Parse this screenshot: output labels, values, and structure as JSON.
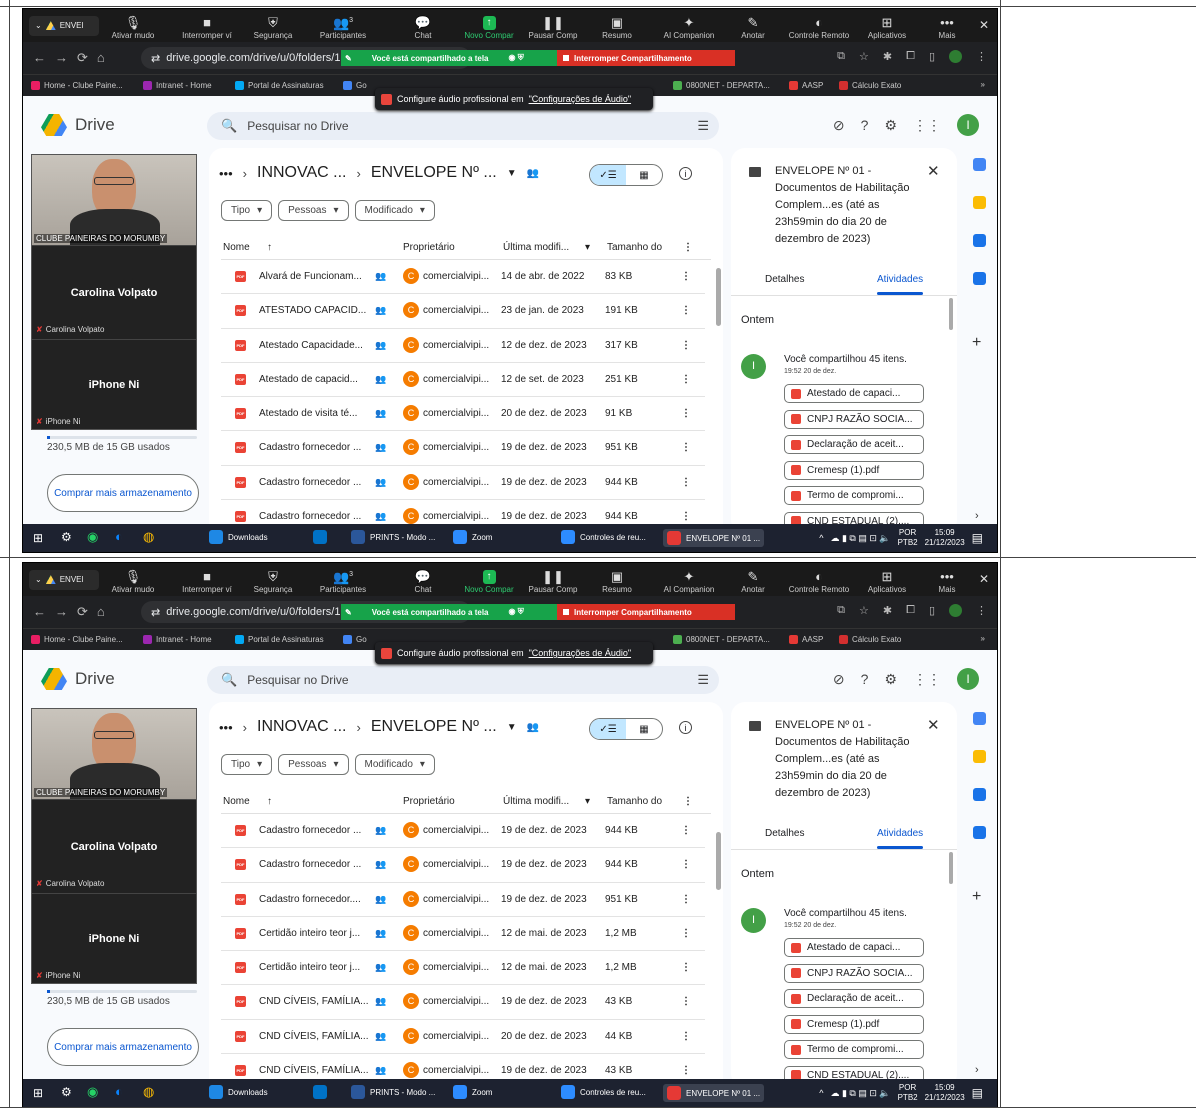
{
  "zoom": {
    "tab_label": "ENVEl",
    "items": [
      {
        "label": "Ativar mudo",
        "glyph": "🎙"
      },
      {
        "label": "Interromper ví",
        "glyph": "■"
      },
      {
        "label": "Segurança",
        "glyph": "⛨"
      },
      {
        "label": "Participantes",
        "glyph": "👥"
      },
      {
        "label": "Chat",
        "glyph": "💬"
      },
      {
        "label": "Novo Compar",
        "glyph": "↑"
      },
      {
        "label": "Pausar Comp",
        "glyph": "❚❚"
      },
      {
        "label": "Resumo",
        "glyph": "▣"
      },
      {
        "label": "AI Companion",
        "glyph": "✦"
      },
      {
        "label": "Anotar",
        "glyph": "✎"
      },
      {
        "label": "Controle Remoto",
        "glyph": "◐"
      },
      {
        "label": "Aplicativos",
        "glyph": "⊞"
      },
      {
        "label": "Mais",
        "glyph": "•••"
      }
    ],
    "participants_count": "3",
    "close": "✕"
  },
  "browser": {
    "url": "drive.google.com/drive/u/0/folders/1UD",
    "sharing_text": "Você está compartilhado a tela",
    "stop_sharing": "Interromper Compartilhamento",
    "bookmarks": [
      {
        "label": "Home - Clube Paine...",
        "color": "#e91e63"
      },
      {
        "label": "Intranet - Home",
        "color": "#9c27b0"
      },
      {
        "label": "Portal de Assinaturas",
        "color": "#03a9f4"
      },
      {
        "label": "Go",
        "color": "#4285f4"
      },
      {
        "label": "0800NET - DEPARTA...",
        "color": "#4caf50"
      },
      {
        "label": "AASP",
        "color": "#e53935"
      },
      {
        "label": "Cálculo Exato",
        "color": "#d32f2f"
      }
    ],
    "bookmarks_more": "»",
    "tooltip_prefix": "Configure áudio profissional em",
    "tooltip_link": "\"Configurações de Áudio\""
  },
  "drive": {
    "app_name": "Drive",
    "search_placeholder": "Pesquisar no Drive",
    "avatar_letter": "I",
    "breadcrumb_dots": "•••",
    "breadcrumb_1": "INNOVAC ...",
    "breadcrumb_2": "ENVELOPE Nº ...",
    "filters": [
      "Tipo",
      "Pessoas",
      "Modificado"
    ],
    "columns": {
      "name": "Nome",
      "owner": "Proprietário",
      "modified": "Última modifi...",
      "size": "Tamanho do"
    },
    "storage_text": "230,5 MB de 15 GB usados",
    "storage_fraction": 0.015,
    "buy_storage": "Comprar mais armazenamento",
    "panel": {
      "title": "ENVELOPE Nº 01 - Documentos de Habilitação Complem...es (até as 23h59min do dia 20 de dezembro de 2023)",
      "tab_details": "Detalhes",
      "tab_activity": "Atividades",
      "day": "Ontem",
      "activity_avatar": "I",
      "activity_text": "Você compartilhou 45 itens.",
      "activity_time": "19:52 20 de dez.",
      "files": [
        "Atestado de capaci...",
        "CNPJ RAZÃO SOCIA...",
        "Declaração de aceit...",
        "Cremesp (1).pdf",
        "Termo de compromi...",
        "CND ESTADUAL (2)...."
      ]
    }
  },
  "meeting": {
    "video_label": "CLUBE PAINEIRAS DO MORUMBY",
    "participant_1": "Carolina Volpato",
    "participant_2": "iPhone Ni"
  },
  "screens": [
    {
      "rows": [
        {
          "name": "Alvará de Funcionam...",
          "owner": "comercialvipi...",
          "date": "14 de abr. de 2022",
          "size": "83 KB"
        },
        {
          "name": "ATESTADO CAPACID...",
          "owner": "comercialvipi...",
          "date": "23 de jan. de 2023",
          "size": "191 KB"
        },
        {
          "name": "Atestado Capacidade...",
          "owner": "comercialvipi...",
          "date": "12 de dez. de 2023",
          "size": "317 KB"
        },
        {
          "name": "Atestado de capacid...",
          "owner": "comercialvipi...",
          "date": "12 de set. de 2023",
          "size": "251 KB"
        },
        {
          "name": "Atestado de visita té...",
          "owner": "comercialvipi...",
          "date": "20 de dez. de 2023",
          "size": "91 KB"
        },
        {
          "name": "Cadastro fornecedor ...",
          "owner": "comercialvipi...",
          "date": "19 de dez. de 2023",
          "size": "951 KB"
        },
        {
          "name": "Cadastro fornecedor ...",
          "owner": "comercialvipi...",
          "date": "19 de dez. de 2023",
          "size": "944 KB"
        },
        {
          "name": "Cadastro fornecedor ...",
          "owner": "comercialvipi...",
          "date": "19 de dez. de 2023",
          "size": "944 KB"
        }
      ]
    },
    {
      "rows": [
        {
          "name": "Cadastro fornecedor ...",
          "owner": "comercialvipi...",
          "date": "19 de dez. de 2023",
          "size": "944 KB"
        },
        {
          "name": "Cadastro fornecedor ...",
          "owner": "comercialvipi...",
          "date": "19 de dez. de 2023",
          "size": "944 KB"
        },
        {
          "name": "Cadastro fornecedor....",
          "owner": "comercialvipi...",
          "date": "19 de dez. de 2023",
          "size": "951 KB"
        },
        {
          "name": "Certidão inteiro teor j...",
          "owner": "comercialvipi...",
          "date": "12 de mai. de 2023",
          "size": "1,2 MB"
        },
        {
          "name": "Certidão inteiro teor j...",
          "owner": "comercialvipi...",
          "date": "12 de mai. de 2023",
          "size": "1,2 MB"
        },
        {
          "name": "CND CÍVEIS, FAMÍLIA...",
          "owner": "comercialvipi...",
          "date": "19 de dez. de 2023",
          "size": "43 KB"
        },
        {
          "name": "CND CÍVEIS, FAMÍLIA...",
          "owner": "comercialvipi...",
          "date": "20 de dez. de 2023",
          "size": "44 KB"
        },
        {
          "name": "CND CÍVEIS, FAMÍLIA...",
          "owner": "comercialvipi...",
          "date": "19 de dez. de 2023",
          "size": "43 KB"
        }
      ]
    }
  ],
  "taskbar": {
    "items": [
      {
        "label": "Downloads",
        "color": "#1e88e5"
      },
      {
        "label": "",
        "color": "#0072c6"
      },
      {
        "label": "PRINTS - Modo ...",
        "color": "#2b579a"
      },
      {
        "label": "Zoom",
        "color": "#2d8cff"
      },
      {
        "label": "Controles de reu...",
        "color": "#2d8cff"
      },
      {
        "label": "ENVELOPE Nº 01 ...",
        "color": "#e53935"
      }
    ],
    "lang_1": "POR",
    "lang_2": "PTB2",
    "time": "15:09",
    "date": "21/12/2023"
  }
}
